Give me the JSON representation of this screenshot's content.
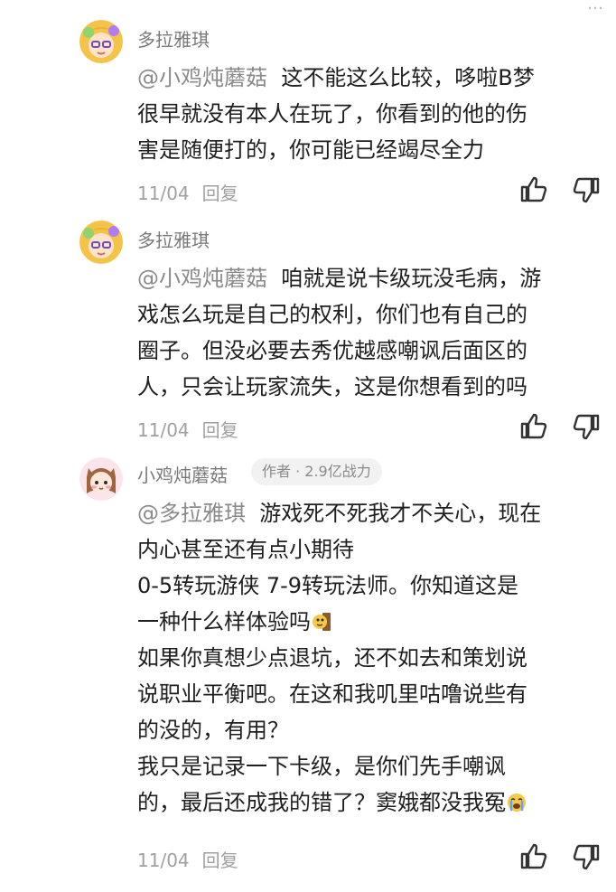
{
  "header": {
    "more_label": "…"
  },
  "comments": [
    {
      "username": "多拉雅琪",
      "mention": "@小鸡炖蘑菇",
      "lines": [
        "这不能这么比较，哆啦B梦",
        "很早就没有本人在玩了，你看到的他的伤",
        "害是随便打的，你可能已经竭尽全力"
      ],
      "date": "11/04",
      "reply_label": "回复",
      "like_icon": "thumbs-up-icon",
      "dislike_icon": "thumbs-down-icon"
    },
    {
      "username": "多拉雅琪",
      "mention": "@小鸡炖蘑菇",
      "lines": [
        "咱就是说卡级玩没毛病，游",
        "戏怎么玩是自己的权利，你们也有自己的",
        "圈子。但没必要去秀优越感嘲讽后面区的",
        "人，只会让玩家流失，这是你想看到的吗"
      ],
      "date": "11/04",
      "reply_label": "回复",
      "like_icon": "thumbs-up-icon",
      "dislike_icon": "thumbs-down-icon"
    },
    {
      "username": "小鸡炖蘑菇",
      "badge": "作者 · 2.9亿战力",
      "mention": "@多拉雅琪",
      "lines": [
        "游戏死不死我才不关心，现在",
        "内心甚至还有点小期待",
        "0-5转玩游侠 7-9转玩法师。你知道这是",
        "一种什么样体验吗",
        "如果你真想少点退坑，还不如去和策划说",
        "说职业平衡吧。在这和我叽里咕噜说些有",
        "的没的，有用？",
        "我只是记录一下卡级，是你们先手嘲讽",
        "的，最后还成我的错了？窦娥都没我冤"
      ],
      "emojis": [
        "peek-emoji-icon",
        "crying-emoji-icon"
      ],
      "date": "11/04",
      "reply_label": "回复",
      "like_icon": "thumbs-up-icon",
      "dislike_icon": "thumbs-down-icon"
    }
  ]
}
